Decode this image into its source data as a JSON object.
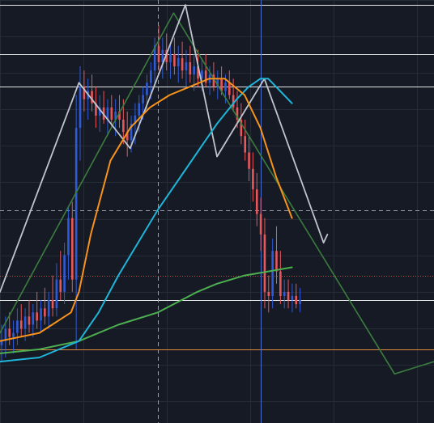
{
  "colors": {
    "background": "#161a25",
    "grid": "#262b38",
    "candle_up": "#2f5bd9",
    "candle_down": "#e8575a",
    "ma_orange": "#f7931a",
    "ma_cyan": "#1fb5d8",
    "ma_green": "#4caf50",
    "zigzag_grey": "#c0c4cc",
    "zigzag_green": "#3b7d3e",
    "hline_white": "#e6e6e6",
    "hline_dashed": "#9aa0aa",
    "hline_red_dotted": "#c0504d",
    "hline_orange": "#e08a3c",
    "crosshair": "#9aa0aa",
    "vline_blue": "#4a6fd1"
  },
  "chart_data": {
    "type": "candlestick",
    "title": "",
    "xlabel": "",
    "ylabel": "",
    "x_range": [
      0,
      110
    ],
    "y_range": [
      0,
      100
    ],
    "grid": true,
    "candles": [
      {
        "o": 17,
        "h": 22,
        "l": 13,
        "c": 18
      },
      {
        "o": 18,
        "h": 24,
        "l": 14,
        "c": 21
      },
      {
        "o": 21,
        "h": 25,
        "l": 17,
        "c": 19
      },
      {
        "o": 19,
        "h": 23,
        "l": 15,
        "c": 20
      },
      {
        "o": 20,
        "h": 26,
        "l": 17,
        "c": 23
      },
      {
        "o": 23,
        "h": 27,
        "l": 19,
        "c": 21
      },
      {
        "o": 21,
        "h": 26,
        "l": 18,
        "c": 24
      },
      {
        "o": 24,
        "h": 28,
        "l": 20,
        "c": 22
      },
      {
        "o": 22,
        "h": 27,
        "l": 19,
        "c": 25
      },
      {
        "o": 25,
        "h": 30,
        "l": 21,
        "c": 23
      },
      {
        "o": 23,
        "h": 28,
        "l": 20,
        "c": 26
      },
      {
        "o": 26,
        "h": 31,
        "l": 22,
        "c": 24
      },
      {
        "o": 24,
        "h": 30,
        "l": 21,
        "c": 28
      },
      {
        "o": 28,
        "h": 34,
        "l": 24,
        "c": 26
      },
      {
        "o": 26,
        "h": 37,
        "l": 24,
        "c": 33
      },
      {
        "o": 33,
        "h": 40,
        "l": 28,
        "c": 30
      },
      {
        "o": 30,
        "h": 42,
        "l": 27,
        "c": 39
      },
      {
        "o": 39,
        "h": 51,
        "l": 33,
        "c": 48
      },
      {
        "o": 48,
        "h": 52,
        "l": 30,
        "c": 33
      },
      {
        "o": 33,
        "h": 78,
        "l": 16,
        "c": 70
      },
      {
        "o": 70,
        "h": 85,
        "l": 62,
        "c": 80
      },
      {
        "o": 80,
        "h": 84,
        "l": 74,
        "c": 77
      },
      {
        "o": 77,
        "h": 82,
        "l": 72,
        "c": 79
      },
      {
        "o": 79,
        "h": 83,
        "l": 74,
        "c": 76
      },
      {
        "o": 76,
        "h": 80,
        "l": 70,
        "c": 73
      },
      {
        "o": 73,
        "h": 78,
        "l": 69,
        "c": 75
      },
      {
        "o": 75,
        "h": 79,
        "l": 71,
        "c": 72
      },
      {
        "o": 72,
        "h": 77,
        "l": 68,
        "c": 75
      },
      {
        "o": 75,
        "h": 78,
        "l": 70,
        "c": 72
      },
      {
        "o": 72,
        "h": 77,
        "l": 68,
        "c": 74
      },
      {
        "o": 74,
        "h": 78,
        "l": 70,
        "c": 72
      },
      {
        "o": 72,
        "h": 77,
        "l": 66,
        "c": 69
      },
      {
        "o": 69,
        "h": 74,
        "l": 63,
        "c": 67
      },
      {
        "o": 67,
        "h": 73,
        "l": 64,
        "c": 71
      },
      {
        "o": 71,
        "h": 76,
        "l": 66,
        "c": 73
      },
      {
        "o": 73,
        "h": 78,
        "l": 69,
        "c": 76
      },
      {
        "o": 76,
        "h": 80,
        "l": 72,
        "c": 78
      },
      {
        "o": 78,
        "h": 83,
        "l": 74,
        "c": 81
      },
      {
        "o": 81,
        "h": 86,
        "l": 77,
        "c": 84
      },
      {
        "o": 84,
        "h": 92,
        "l": 80,
        "c": 90
      },
      {
        "o": 90,
        "h": 95,
        "l": 84,
        "c": 86
      },
      {
        "o": 86,
        "h": 92,
        "l": 82,
        "c": 89
      },
      {
        "o": 89,
        "h": 93,
        "l": 84,
        "c": 86
      },
      {
        "o": 86,
        "h": 91,
        "l": 82,
        "c": 88
      },
      {
        "o": 88,
        "h": 92,
        "l": 83,
        "c": 85
      },
      {
        "o": 85,
        "h": 90,
        "l": 81,
        "c": 87
      },
      {
        "o": 87,
        "h": 91,
        "l": 82,
        "c": 84
      },
      {
        "o": 84,
        "h": 89,
        "l": 80,
        "c": 86
      },
      {
        "o": 86,
        "h": 90,
        "l": 81,
        "c": 83
      },
      {
        "o": 83,
        "h": 88,
        "l": 79,
        "c": 85
      },
      {
        "o": 85,
        "h": 89,
        "l": 80,
        "c": 82
      },
      {
        "o": 82,
        "h": 87,
        "l": 79,
        "c": 84
      },
      {
        "o": 84,
        "h": 88,
        "l": 80,
        "c": 81
      },
      {
        "o": 81,
        "h": 85,
        "l": 78,
        "c": 83
      },
      {
        "o": 83,
        "h": 86,
        "l": 79,
        "c": 80
      },
      {
        "o": 80,
        "h": 84,
        "l": 77,
        "c": 82
      },
      {
        "o": 82,
        "h": 85,
        "l": 78,
        "c": 79
      },
      {
        "o": 79,
        "h": 83,
        "l": 76,
        "c": 81
      },
      {
        "o": 81,
        "h": 84,
        "l": 77,
        "c": 78
      },
      {
        "o": 78,
        "h": 82,
        "l": 74,
        "c": 75
      },
      {
        "o": 75,
        "h": 79,
        "l": 70,
        "c": 72
      },
      {
        "o": 72,
        "h": 76,
        "l": 66,
        "c": 68
      },
      {
        "o": 68,
        "h": 72,
        "l": 62,
        "c": 64
      },
      {
        "o": 64,
        "h": 68,
        "l": 57,
        "c": 60
      },
      {
        "o": 60,
        "h": 64,
        "l": 52,
        "c": 55
      },
      {
        "o": 55,
        "h": 59,
        "l": 46,
        "c": 49
      },
      {
        "o": 49,
        "h": 53,
        "l": 40,
        "c": 44
      },
      {
        "o": 44,
        "h": 48,
        "l": 26,
        "c": 30
      },
      {
        "o": 30,
        "h": 34,
        "l": 25,
        "c": 29
      },
      {
        "o": 29,
        "h": 43,
        "l": 26,
        "c": 40
      },
      {
        "o": 40,
        "h": 46,
        "l": 32,
        "c": 35
      },
      {
        "o": 35,
        "h": 40,
        "l": 27,
        "c": 29
      },
      {
        "o": 29,
        "h": 33,
        "l": 26,
        "c": 30
      },
      {
        "o": 30,
        "h": 33,
        "l": 26,
        "c": 28
      },
      {
        "o": 28,
        "h": 32,
        "l": 25,
        "c": 29
      },
      {
        "o": 29,
        "h": 32,
        "l": 26,
        "c": 27
      },
      {
        "o": 27,
        "h": 31,
        "l": 25,
        "c": 28
      }
    ],
    "ma_orange": [
      [
        0,
        18
      ],
      [
        10,
        20
      ],
      [
        18,
        25
      ],
      [
        20,
        30
      ],
      [
        23,
        44
      ],
      [
        28,
        62
      ],
      [
        33,
        70
      ],
      [
        38,
        75
      ],
      [
        43,
        78
      ],
      [
        48,
        80
      ],
      [
        53,
        82
      ],
      [
        57,
        82
      ],
      [
        62,
        78
      ],
      [
        66,
        70
      ],
      [
        70,
        58
      ],
      [
        74,
        48
      ]
    ],
    "ma_cyan": [
      [
        0,
        13
      ],
      [
        10,
        14
      ],
      [
        20,
        18
      ],
      [
        25,
        25
      ],
      [
        30,
        34
      ],
      [
        35,
        42
      ],
      [
        40,
        50
      ],
      [
        45,
        57
      ],
      [
        50,
        64
      ],
      [
        55,
        71
      ],
      [
        60,
        77
      ],
      [
        63,
        80
      ],
      [
        66,
        82
      ],
      [
        68,
        82
      ],
      [
        71,
        79
      ],
      [
        74,
        76
      ]
    ],
    "ma_green": [
      [
        0,
        15
      ],
      [
        10,
        16
      ],
      [
        20,
        18
      ],
      [
        30,
        22
      ],
      [
        40,
        25
      ],
      [
        50,
        30
      ],
      [
        55,
        32
      ],
      [
        62,
        34
      ],
      [
        68,
        35
      ],
      [
        74,
        36
      ]
    ],
    "zigzag_grey": [
      [
        0,
        30
      ],
      [
        20,
        81
      ],
      [
        33,
        65
      ],
      [
        47,
        100
      ],
      [
        55,
        63
      ],
      [
        67,
        82
      ],
      [
        82,
        42
      ],
      [
        83,
        44
      ]
    ],
    "zigzag_green": [
      [
        0,
        20
      ],
      [
        44,
        98
      ],
      [
        100,
        10
      ],
      [
        110,
        13
      ]
    ],
    "hlines": [
      {
        "y": 100,
        "style": "solid",
        "color": "white"
      },
      {
        "y": 88,
        "style": "solid",
        "color": "white"
      },
      {
        "y": 80,
        "style": "solid",
        "color": "white"
      },
      {
        "y": 50,
        "style": "dashed",
        "color": "grey"
      },
      {
        "y": 34,
        "style": "dotted",
        "color": "red"
      },
      {
        "y": 28,
        "style": "solid",
        "color": "white"
      },
      {
        "y": 16,
        "style": "solid",
        "color": "orange"
      }
    ],
    "vlines": [
      {
        "x": 40,
        "style": "dashed",
        "color": "grey"
      },
      {
        "x": 66,
        "style": "solid",
        "color": "blue"
      }
    ]
  }
}
